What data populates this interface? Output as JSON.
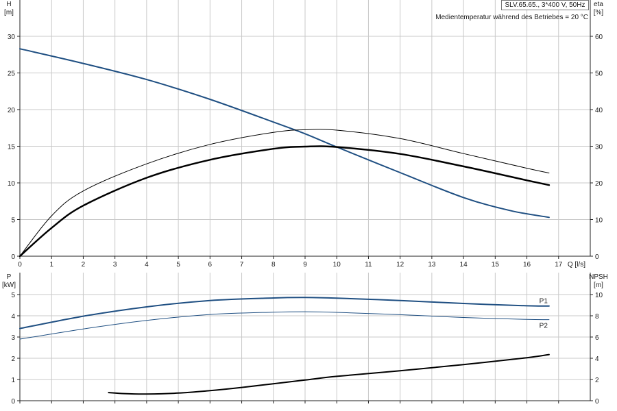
{
  "header": {
    "info_box": "SLV.65.65., 3*400 V, 50Hz",
    "temperature_note": "Medientemperatur während des Betriebes = 20 °C"
  },
  "colors": {
    "blue": "#1f4f82",
    "black": "#000000",
    "grid": "#c8c8c8"
  },
  "chart_data": [
    {
      "type": "line",
      "panel": "top",
      "x_label": "Q [l/s]",
      "y_left_label": [
        "H",
        "[m]"
      ],
      "y_right_label": [
        "eta",
        "[%]"
      ],
      "xlim": [
        0,
        18
      ],
      "ylim_left": [
        0,
        35
      ],
      "ylim_right": [
        0,
        70
      ],
      "x_ticks": [
        0,
        1,
        2,
        3,
        4,
        5,
        6,
        7,
        8,
        9,
        10,
        11,
        12,
        13,
        14,
        15,
        16,
        17
      ],
      "y_left_ticks": [
        0,
        5,
        10,
        15,
        20,
        25,
        30
      ],
      "y_right_ticks": [
        0,
        10,
        20,
        30,
        40,
        50,
        60
      ],
      "grid": true,
      "series": [
        {
          "axis": "left",
          "color": "#1f4f82",
          "width": 2,
          "points": [
            [
              0,
              28.3
            ],
            [
              2,
              26.3
            ],
            [
              4,
              24.1
            ],
            [
              6,
              21.4
            ],
            [
              8,
              18.3
            ],
            [
              9,
              16.7
            ],
            [
              10,
              14.9
            ],
            [
              12,
              11.4
            ],
            [
              14,
              8.0
            ],
            [
              15.5,
              6.2
            ],
            [
              16.7,
              5.3
            ]
          ]
        },
        {
          "axis": "right",
          "color": "#000000",
          "width": 1,
          "points": [
            [
              0,
              0
            ],
            [
              1,
              11
            ],
            [
              2,
              17.8
            ],
            [
              4,
              25.2
            ],
            [
              6,
              30.5
            ],
            [
              8,
              33.8
            ],
            [
              9,
              34.5
            ],
            [
              10,
              34.4
            ],
            [
              12,
              32.1
            ],
            [
              14,
              28.0
            ],
            [
              16,
              24.0
            ],
            [
              16.7,
              22.7
            ]
          ]
        },
        {
          "axis": "right",
          "color": "#000000",
          "width": 2.5,
          "points": [
            [
              0,
              0
            ],
            [
              1,
              7.7
            ],
            [
              2,
              13.8
            ],
            [
              4,
              21.4
            ],
            [
              6,
              26.3
            ],
            [
              8,
              29.3
            ],
            [
              9,
              29.9
            ],
            [
              10,
              29.8
            ],
            [
              12,
              27.9
            ],
            [
              14,
              24.5
            ],
            [
              16,
              20.7
            ],
            [
              16.7,
              19.4
            ]
          ]
        }
      ]
    },
    {
      "type": "line",
      "panel": "bottom",
      "y_left_label": [
        "P",
        "[kW]"
      ],
      "y_right_label": [
        "NPSH",
        "[m]"
      ],
      "xlim": [
        0,
        18
      ],
      "ylim_left": [
        0,
        5.5
      ],
      "ylim_right": [
        0,
        11
      ],
      "x_ticks": [
        0,
        1,
        2,
        3,
        4,
        5,
        6,
        7,
        8,
        9,
        10,
        11,
        12,
        13,
        14,
        15,
        16,
        17
      ],
      "y_left_ticks": [
        0,
        1,
        2,
        3,
        4,
        5
      ],
      "y_right_ticks": [
        0,
        2,
        4,
        6,
        8,
        10
      ],
      "grid": true,
      "series": [
        {
          "name": "P1",
          "axis": "left",
          "color": "#1f4f82",
          "width": 2,
          "points": [
            [
              0,
              3.4
            ],
            [
              2,
              3.98
            ],
            [
              4,
              4.42
            ],
            [
              6,
              4.72
            ],
            [
              8,
              4.84
            ],
            [
              9,
              4.86
            ],
            [
              10,
              4.83
            ],
            [
              12,
              4.72
            ],
            [
              14,
              4.58
            ],
            [
              16,
              4.47
            ],
            [
              16.7,
              4.46
            ]
          ]
        },
        {
          "name": "P2",
          "axis": "left",
          "color": "#1f4f82",
          "width": 1,
          "points": [
            [
              0,
              2.9
            ],
            [
              2,
              3.38
            ],
            [
              4,
              3.78
            ],
            [
              6,
              4.06
            ],
            [
              8,
              4.17
            ],
            [
              9,
              4.19
            ],
            [
              10,
              4.16
            ],
            [
              12,
              4.05
            ],
            [
              14,
              3.92
            ],
            [
              16,
              3.83
            ],
            [
              16.7,
              3.82
            ]
          ]
        },
        {
          "axis": "right",
          "color": "#000000",
          "width": 2,
          "points": [
            [
              2.8,
              0.77
            ],
            [
              3.3,
              0.67
            ],
            [
              4,
              0.63
            ],
            [
              5,
              0.72
            ],
            [
              6,
              0.95
            ],
            [
              7,
              1.25
            ],
            [
              8,
              1.6
            ],
            [
              9,
              1.95
            ],
            [
              10,
              2.3
            ],
            [
              12,
              2.82
            ],
            [
              14,
              3.4
            ],
            [
              16,
              4.05
            ],
            [
              16.7,
              4.35
            ]
          ]
        }
      ]
    }
  ]
}
